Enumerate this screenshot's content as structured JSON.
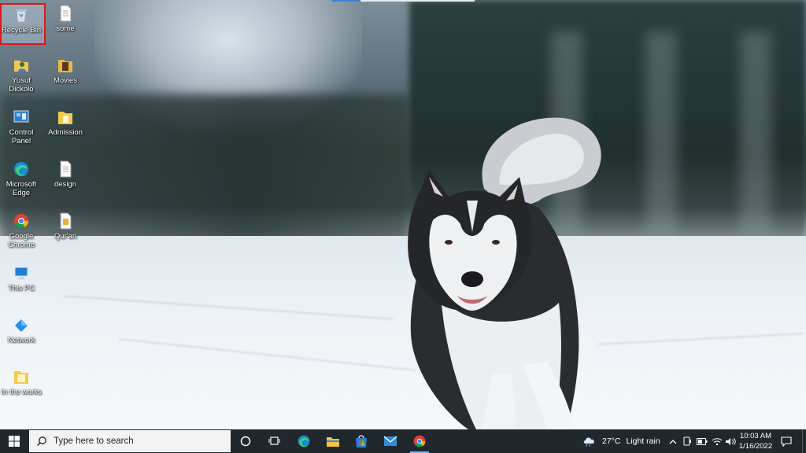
{
  "desktop": {
    "icons": [
      {
        "label": "Recycle Bin",
        "icon": "recycle-bin-icon"
      },
      {
        "label": "some",
        "icon": "document-icon"
      },
      {
        "label": "Yusuf Dickolo",
        "icon": "user-folder-icon"
      },
      {
        "label": "Movies",
        "icon": "folder-icon"
      },
      {
        "label": "Control Panel",
        "icon": "control-panel-icon"
      },
      {
        "label": "Admission",
        "icon": "folder-icon"
      },
      {
        "label": "Microsoft Edge",
        "icon": "edge-icon"
      },
      {
        "label": "design",
        "icon": "document-icon"
      },
      {
        "label": "Google Chrome",
        "icon": "chrome-icon"
      },
      {
        "label": "Qur'an",
        "icon": "document-icon"
      },
      {
        "label": "This PC",
        "icon": "this-pc-icon"
      },
      {
        "label": "Network",
        "icon": "network-icon"
      },
      {
        "label": "In the works",
        "icon": "folder-icon"
      }
    ]
  },
  "taskbar": {
    "search_placeholder": "Type here to search",
    "weather_temp": "27°C",
    "weather_desc": "Light rain",
    "time": "10:03 AM",
    "date": "1/16/2022"
  },
  "colors": {
    "taskbar_bg": "#20272d",
    "selection_border": "#e0161b",
    "active_indicator": "#78b4f0"
  }
}
